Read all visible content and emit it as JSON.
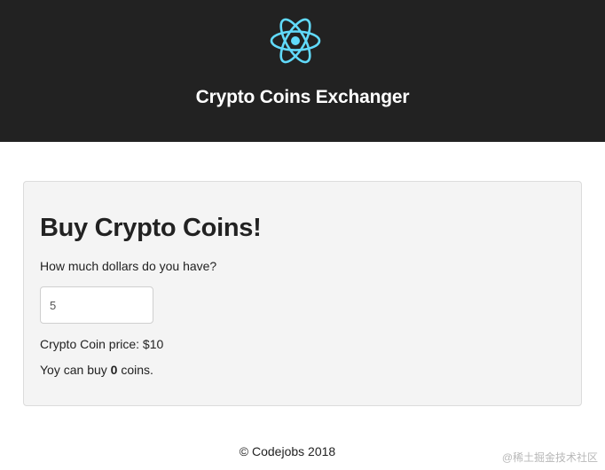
{
  "header": {
    "logo_icon": "react-atom-icon",
    "logo_color": "#61dafb",
    "background": "#222222",
    "title": "Crypto Coins Exchanger"
  },
  "card": {
    "title": "Buy Crypto Coins!",
    "question": "How much dollars do you have?",
    "dollar_input": {
      "value": "5",
      "placeholder": ""
    },
    "price_text": "Crypto Coin price: $10",
    "result_prefix": "Yoy can buy ",
    "result_count": "0",
    "result_suffix": " coins."
  },
  "footer": {
    "copyright": "© Codejobs 2018"
  },
  "watermark": "@稀土掘金技术社区"
}
